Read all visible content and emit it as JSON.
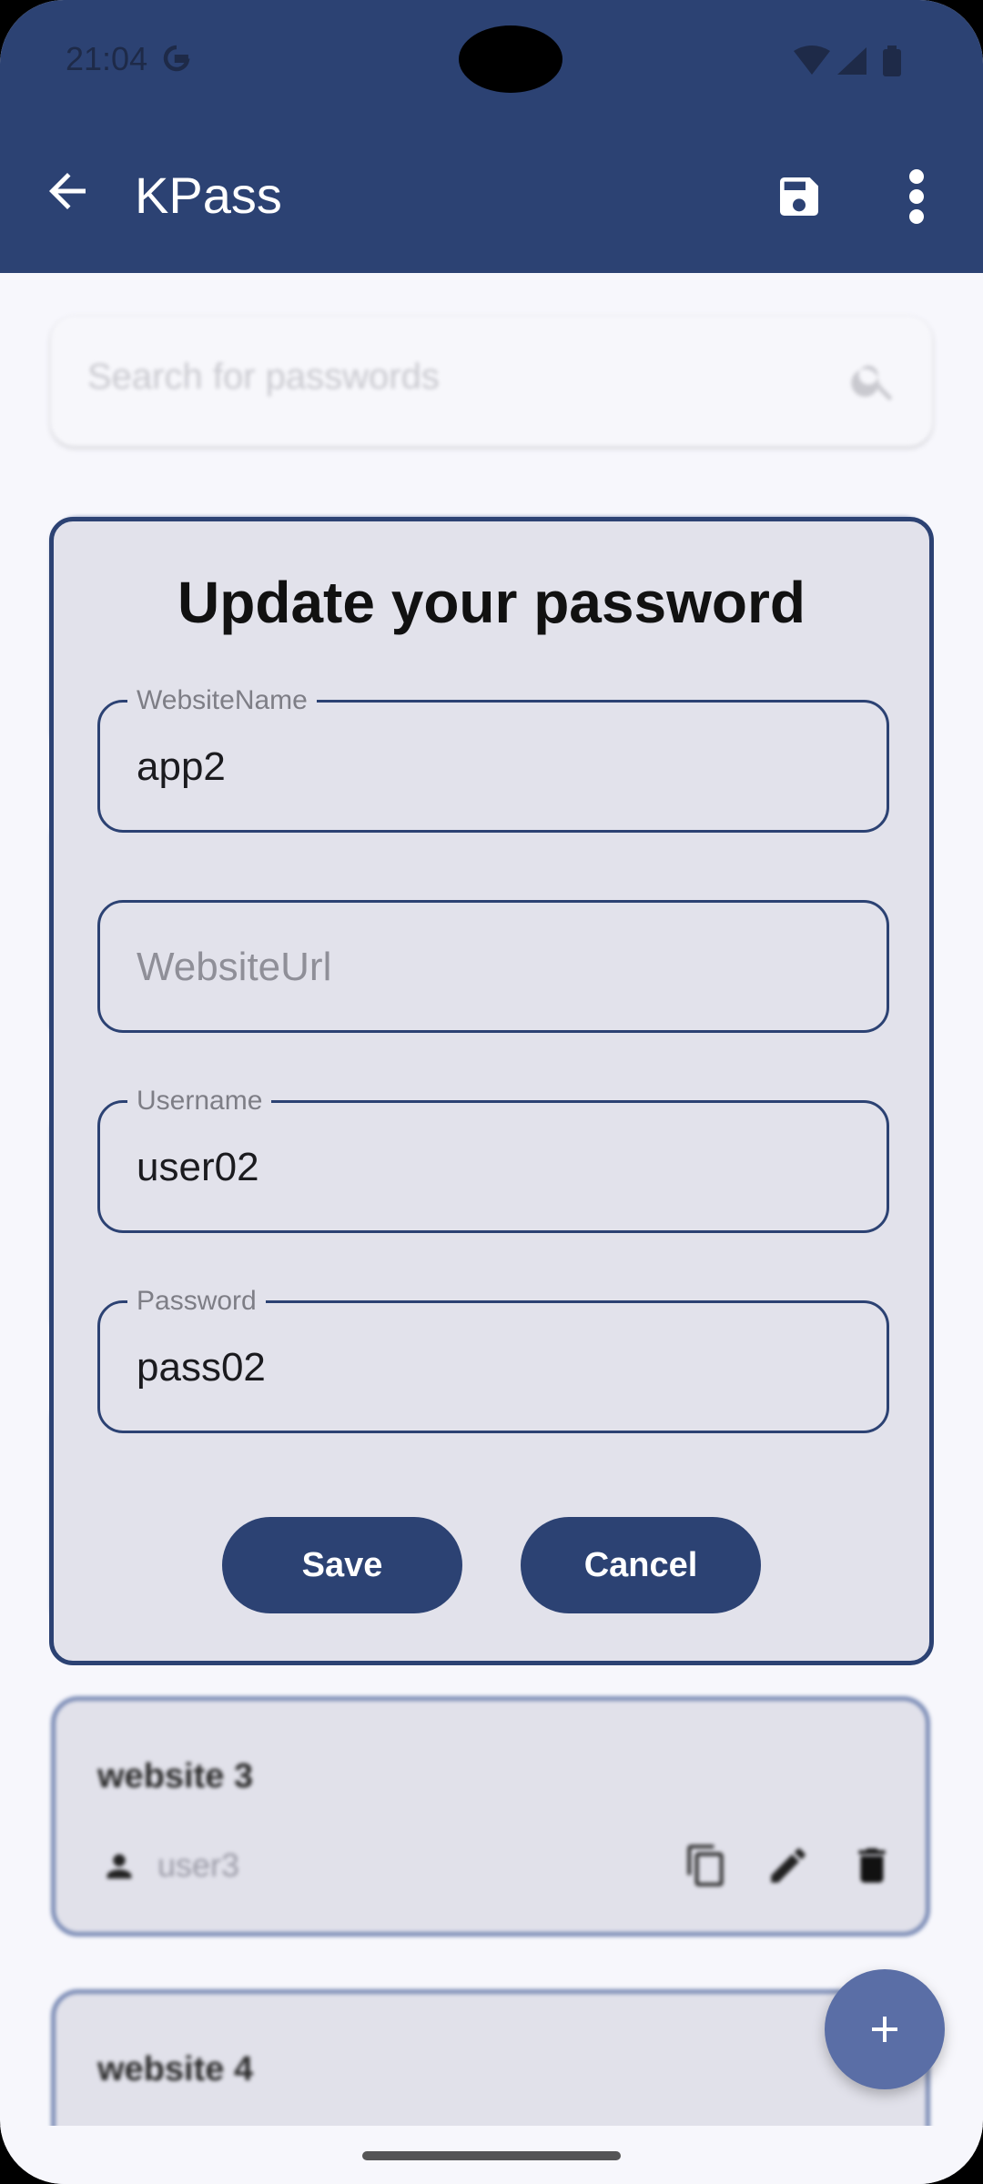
{
  "status_bar": {
    "time": "21:04"
  },
  "app_bar": {
    "title": "KPass"
  },
  "search": {
    "placeholder": "Search for passwords"
  },
  "cards": [
    {
      "title": "website 3",
      "username": "user3"
    },
    {
      "title": "website 4"
    }
  ],
  "dialog": {
    "title": "Update your password",
    "fields": {
      "website_name": {
        "label": "WebsiteName",
        "value": "app2"
      },
      "website_url": {
        "placeholder": "WebsiteUrl"
      },
      "username": {
        "label": "Username",
        "value": "user02"
      },
      "password": {
        "label": "Password",
        "value": "pass02"
      }
    },
    "save_label": "Save",
    "cancel_label": "Cancel"
  },
  "colors": {
    "primary": "#2c4273",
    "fab": "#5a6ea6",
    "dialog_bg": "#e2e2eb"
  },
  "icons": [
    "back-arrow-icon",
    "save-icon",
    "more-vert-icon",
    "search-icon",
    "person-icon",
    "copy-icon",
    "edit-icon",
    "delete-icon",
    "add-icon"
  ]
}
